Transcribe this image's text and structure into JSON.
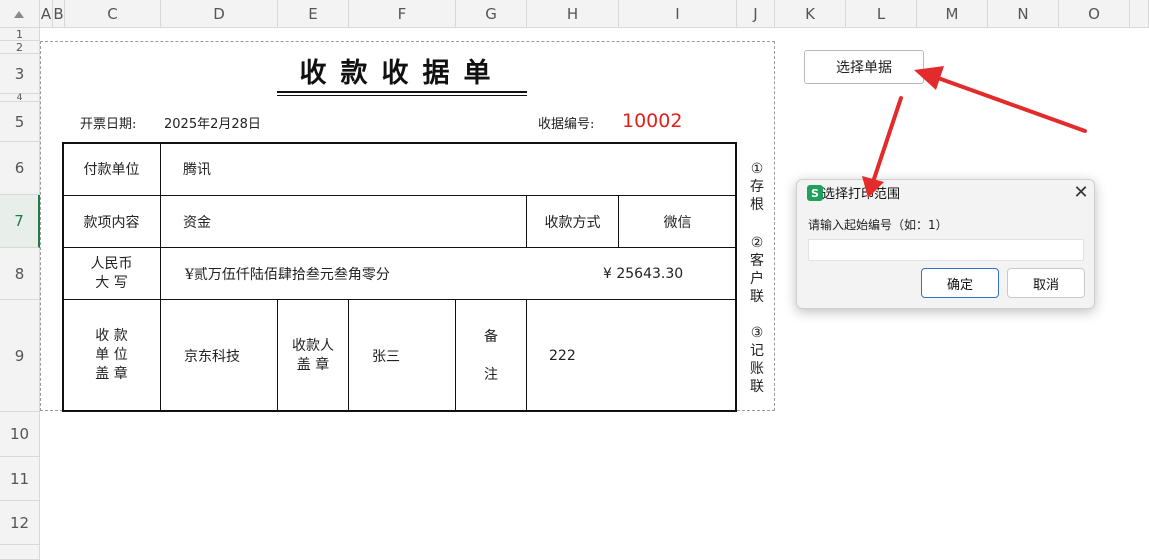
{
  "sheet": {
    "columns": [
      "A",
      "B",
      "C",
      "D",
      "E",
      "F",
      "G",
      "H",
      "I",
      "J",
      "K",
      "L",
      "M",
      "N",
      "O"
    ],
    "rows": [
      "1",
      "2",
      "3",
      "4",
      "5",
      "6",
      "7",
      "8",
      "9",
      "10",
      "11",
      "12"
    ]
  },
  "receipt": {
    "title": "收款收据单",
    "date_label": "开票日期:",
    "date_value": "2025年2月28日",
    "number_label": "收据编号:",
    "number_value": "10002",
    "payer_label": "付款单位",
    "payer_value": "腾讯",
    "item_label": "款项内容",
    "item_value": "资金",
    "method_label": "收款方式",
    "method_value": "微信",
    "rmb_label_line1": "人民币",
    "rmb_label_line2": "大 写",
    "amount_words": "¥贰万伍仟陆佰肆拾叁元叁角零分",
    "amount_number": "¥ 25643.30",
    "payee_label_line1": "收 款",
    "payee_label_line2": "单 位",
    "payee_label_line3": "盖 章",
    "payee_value": "京东科技",
    "receiver_label_line1": "收款人",
    "receiver_label_line2": "盖 章",
    "receiver_value": "张三",
    "remark_label_line1": "备",
    "remark_label_line2": "注",
    "remark_value": "222",
    "side_copy1": "①存根",
    "side_copy2": "②客户联",
    "side_copy3": "③记账联"
  },
  "select_button": {
    "label": "选择单据"
  },
  "dialog": {
    "icon_letter": "S",
    "title": "选择打印范围",
    "close_glyph": "✕",
    "prompt": "请输入起始编号（如：1）",
    "input_value": "",
    "ok_label": "确定",
    "cancel_label": "取消"
  },
  "colors": {
    "accent_green": "#1e7c43",
    "receipt_number_red": "#e0201c",
    "arrow_red": "#e32b2b",
    "ok_border_blue": "#3670c9",
    "app_icon_green": "#1fa15c"
  }
}
